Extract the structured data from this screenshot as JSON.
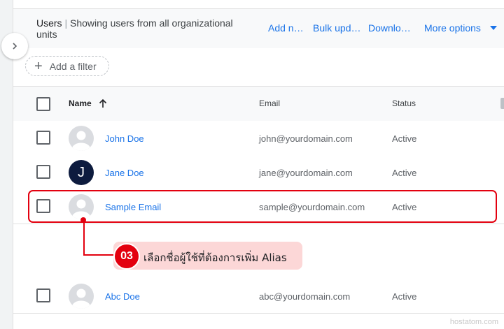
{
  "header": {
    "title_strong": "Users",
    "title_separator": "|",
    "title_rest": "Showing users from all organizational units",
    "actions": [
      "Add n…",
      "Bulk upd…",
      "Downlo…",
      "More options"
    ]
  },
  "filter": {
    "add_label": "Add a filter"
  },
  "table": {
    "columns": {
      "name": "Name",
      "email": "Email",
      "status": "Status"
    },
    "rows": [
      {
        "name": "John Doe",
        "email": "john@yourdomain.com",
        "status": "Active",
        "avatar": "default-avatar-icon"
      },
      {
        "name": "Jane Doe",
        "email": "jane@yourdomain.com",
        "status": "Active",
        "avatar": "initial",
        "initial": "J"
      },
      {
        "name": "Sample Email",
        "email": "sample@yourdomain.com",
        "status": "Active",
        "avatar": "default-avatar-icon"
      },
      {
        "name": "Abc Doe",
        "email": "abc@yourdomain.com",
        "status": "Active",
        "avatar": "default-avatar-icon"
      }
    ]
  },
  "callout": {
    "step": "03",
    "text": "เลือกชื่อผู้ใช้ที่ต้องการเพิ่ม Alias"
  },
  "watermark": "hostatom.com",
  "colors": {
    "link": "#1a73e8",
    "highlight": "#e3000f",
    "callout_bg": "#fcd7d7",
    "jane_avatar": "#0d1b3e"
  }
}
